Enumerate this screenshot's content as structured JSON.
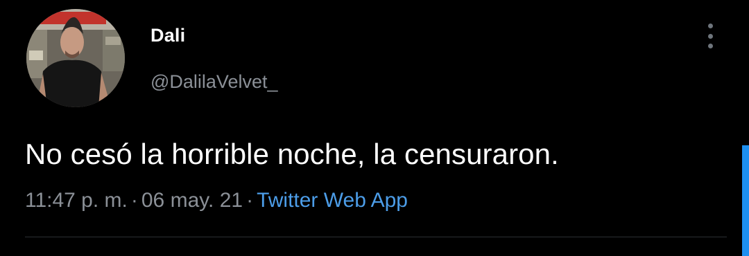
{
  "user": {
    "display_name": "Dali",
    "handle": "@DalilaVelvet_"
  },
  "tweet": {
    "text": "No cesó la horrible noche, la censuraron.",
    "time": "11:47 p. m.",
    "separator": "·",
    "date": "06 may. 21",
    "source": "Twitter Web App"
  },
  "icons": {
    "avatar": "profile-photo",
    "more": "vertical-ellipsis-icon"
  },
  "colors": {
    "background": "#000000",
    "primary_text": "#ffffff",
    "secondary_text": "#8b9097",
    "link": "#4c9de8",
    "accent": "#1d8ff0"
  }
}
